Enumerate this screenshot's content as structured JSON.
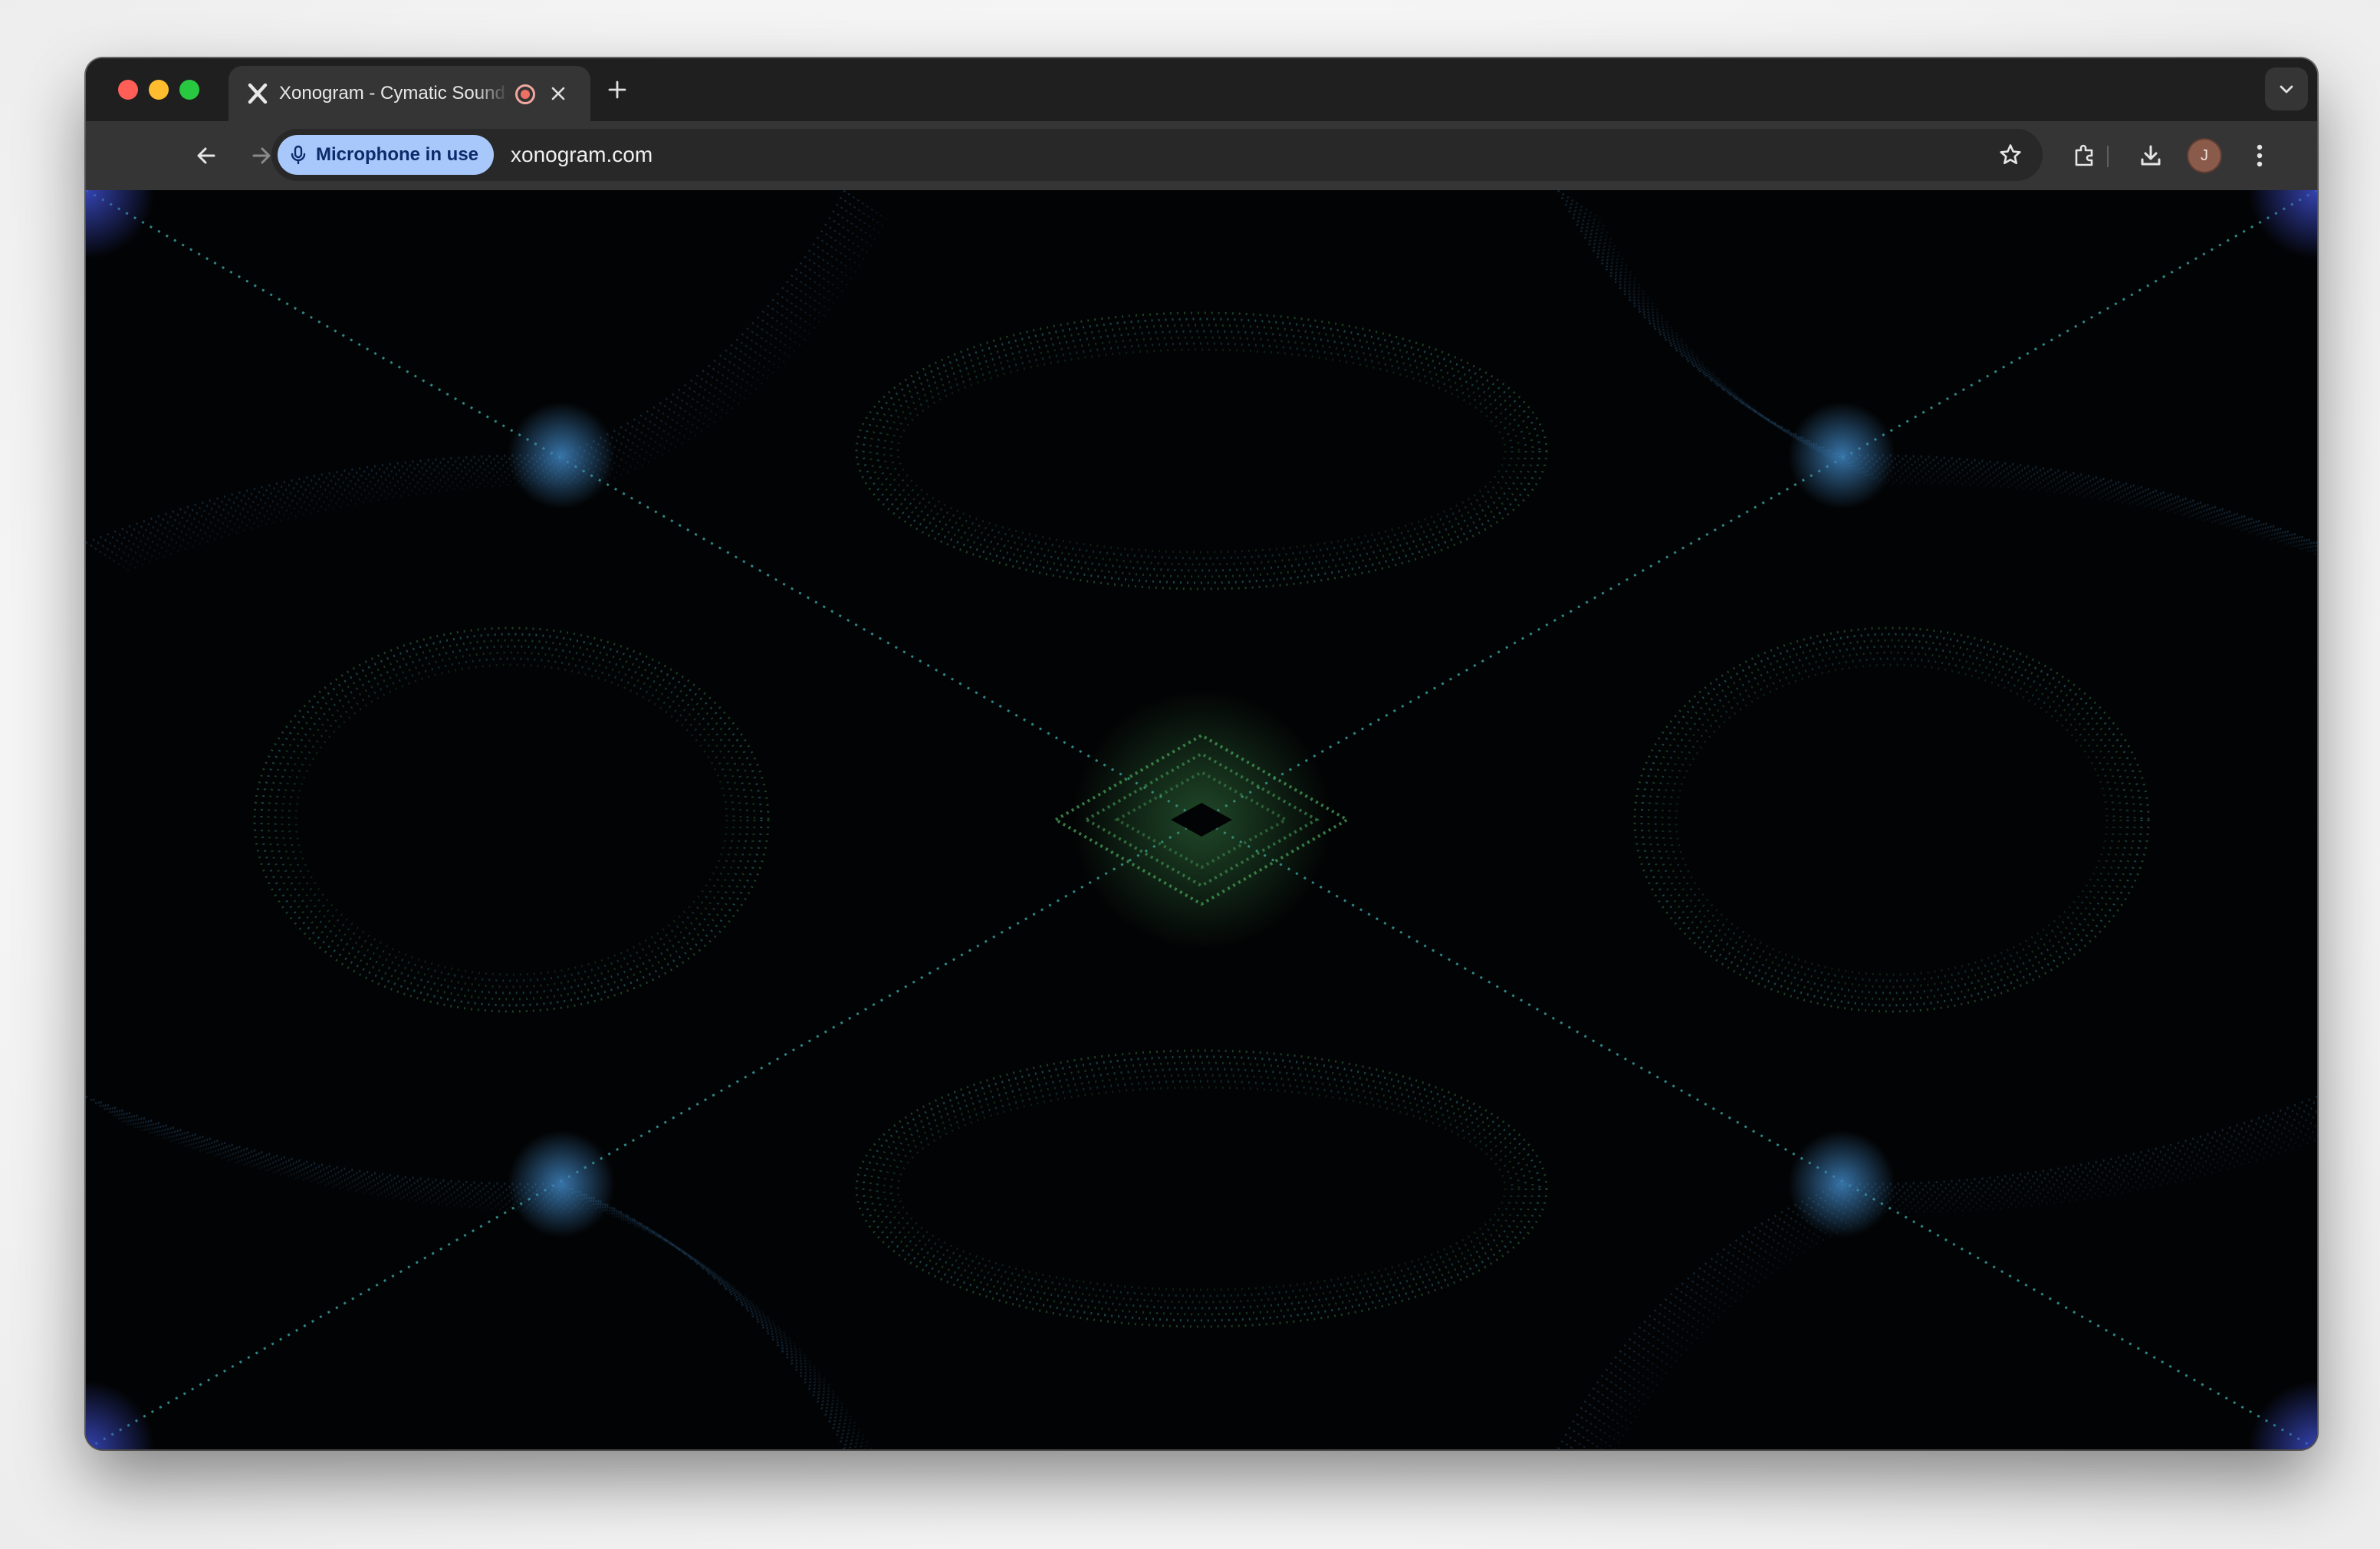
{
  "browser": {
    "tab": {
      "title": "Xonogram - Cymatic Sound Visualizer",
      "favicon": "x-logo-icon",
      "recording_indicator": "recording-icon",
      "close_icon": "close-icon"
    },
    "new_tab_icon": "plus-icon",
    "tab_search_icon": "chevron-down-icon",
    "toolbar": {
      "back_icon": "arrow-left-icon",
      "forward_icon": "arrow-right-icon",
      "reload_icon": "reload-icon",
      "mic_chip_label": "Microphone in use",
      "url": "xonogram.com",
      "bookmark_icon": "star-icon",
      "extensions_icon": "puzzle-icon",
      "downloads_icon": "download-icon",
      "profile_initial": "J",
      "menu_icon": "kebab-menu-icon"
    }
  },
  "colors": {
    "chrome_dark": "#1f1f1f",
    "toolbar": "#353535",
    "omnibox": "#282828",
    "mic_chip": "#a8c7fa",
    "viz_green": "#3f8f4e",
    "viz_teal": "#3aa6a6",
    "viz_blue": "#3d7fb8",
    "viz_indigo": "#3e4fd0"
  }
}
